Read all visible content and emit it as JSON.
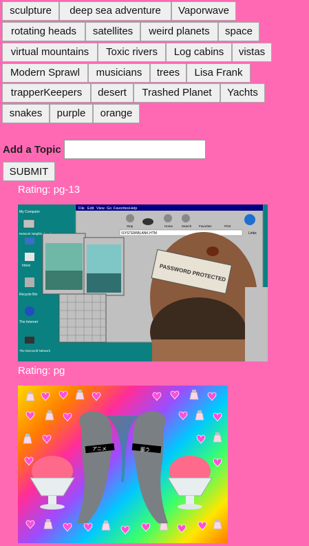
{
  "topics": [
    {
      "label": "sculpture"
    },
    {
      "label": "deep sea adventure"
    },
    {
      "label": "Vaporwave"
    },
    {
      "label": "rotating heads"
    },
    {
      "label": "satellites"
    },
    {
      "label": "weird planets"
    },
    {
      "label": "space"
    },
    {
      "label": "virtual mountains"
    },
    {
      "label": "Toxic rivers"
    },
    {
      "label": "Log cabins"
    },
    {
      "label": "vistas"
    },
    {
      "label": "Modern Sprawl"
    },
    {
      "label": "musicians"
    },
    {
      "label": "trees"
    },
    {
      "label": "Lisa Frank"
    },
    {
      "label": "trapperKeepers"
    },
    {
      "label": "desert"
    },
    {
      "label": "Trashed Planet"
    },
    {
      "label": "Yachts"
    },
    {
      "label": "snakes"
    },
    {
      "label": "purple"
    },
    {
      "label": "orange"
    }
  ],
  "form": {
    "add_topic_label": "Add a Topic",
    "input_value": "",
    "submit_label": "SUBMIT"
  },
  "results": [
    {
      "rating": "Rating: pg-13"
    },
    {
      "rating": "Rating: pg"
    }
  ],
  "gif1_text": {
    "menu": [
      "File",
      "Edit",
      "View",
      "Go",
      "Favorites",
      "Help"
    ],
    "desktop_icons": [
      "My Computer",
      "Network Neighborhood",
      "Inbox",
      "Recycle Bin",
      "The Internet",
      "The Microsoft Network"
    ],
    "toolbar": [
      "Stop",
      "Home",
      "Search",
      "Favorites",
      "Print"
    ],
    "address": "\\SYSTEM\\BLANK.HTM",
    "overlay": "PASSWORD PROTECTED",
    "links": "Links"
  },
  "gif2_text": {
    "band_left": "アニメ",
    "band_right": "廊う"
  },
  "colors": {
    "background": "#ff69b4",
    "button_face": "#efefef"
  }
}
